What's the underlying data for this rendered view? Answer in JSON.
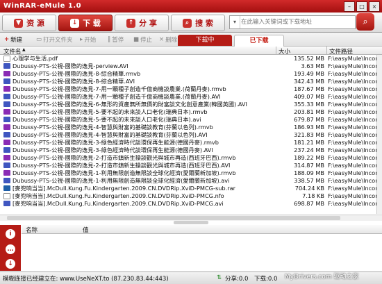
{
  "window": {
    "title": "WinRAR-eMule 1.0"
  },
  "nav": {
    "resources": "资 源",
    "download": "下 载",
    "share": "分 享",
    "search": "搜 索"
  },
  "search": {
    "placeholder": "在此输入关键词或下载地址"
  },
  "toolbar": {
    "new": "新建",
    "open_folder": "打开文件夹",
    "start": "开始",
    "pause": "暂停",
    "stop": "停止",
    "delete": "删除",
    "tab_downloading": "下载中",
    "tab_downloaded": "已下载"
  },
  "columns": {
    "name": "文件名",
    "size": "大小",
    "path": "文件路径"
  },
  "files": [
    {
      "name": "心理学与生活.pdf",
      "size": "135.52 MB",
      "path": "F:\\easyMule\\Incom",
      "type": "pdf"
    },
    {
      "name": "Dubussy-PTS-公視-國際的逸見-perview.AVI",
      "size": "3.63 MB",
      "path": "F:\\easyMule\\Incom",
      "type": "avi"
    },
    {
      "name": "Dubussy-PTS-公視-國際的逸見-8-綜合精華.rmvb",
      "size": "193.49 MB",
      "path": "F:\\easyMule\\Incom",
      "type": "rm"
    },
    {
      "name": "Dubussy-PTS-公視-國際的逸見-8-綜合精華.AVI",
      "size": "342.43 MB",
      "path": "F:\\easyMule\\Incom",
      "type": "avi"
    },
    {
      "name": "Dubussy-PTS-公視-國際的逸見-7-用一顆種子創造千億商機談農業.(荷蘭丹麥).rmvb",
      "size": "187.67 MB",
      "path": "F:\\easyMule\\Incom",
      "type": "rm"
    },
    {
      "name": "Dubussy-PTS-公視-國際的逸見-7-用一顆種子創造千億商機談農業.(荷蘭丹麥).AVI",
      "size": "409.07 MB",
      "path": "F:\\easyMule\\Incom",
      "type": "avi"
    },
    {
      "name": "Dubussy-PTS-公視-國際的逸見-6-無形的資產無所無價的財富談文化創意產業(韓國英國).AVI",
      "size": "355.33 MB",
      "path": "F:\\easyMule\\Incom",
      "type": "avi"
    },
    {
      "name": "Dubussy-PTS-公視-國際的逸見-5-要不起的未來談人口老化(瑞典日本).rmvb",
      "size": "203.81 MB",
      "path": "F:\\easyMule\\Incom",
      "type": "rm"
    },
    {
      "name": "Dubussy-PTS-公視-國際的逸見-5-要不起的未來談人口老化(瑞典日本).avi",
      "size": "679.87 MB",
      "path": "F:\\easyMule\\Incom",
      "type": "avi"
    },
    {
      "name": "Dubussy-PTS-公視-國際的逸見-4-智慧與財富的基礎談教育(芬蘭以色列).rmvb",
      "size": "186.93 MB",
      "path": "F:\\easyMule\\Incom",
      "type": "rm"
    },
    {
      "name": "Dubussy-PTS-公視-國際的逸見-4-智慧與財富的基礎談教育(芬蘭以色列).AVI",
      "size": "321.83 MB",
      "path": "F:\\easyMule\\Incom",
      "type": "avi"
    },
    {
      "name": "Dubussy-PTS-公視-國際的逸見-3-綠色經濟時代談環保再生能源(德國丹麥).rmvb",
      "size": "181.21 MB",
      "path": "F:\\easyMule\\Incom",
      "type": "rm"
    },
    {
      "name": "Dubussy-PTS-公視-國際的逸見-3-綠色經濟時代談環保再生能源(德國丹麥).AVI",
      "size": "237.24 MB",
      "path": "F:\\easyMule\\Incom",
      "type": "avi"
    },
    {
      "name": "Dubussy-PTS-公視-國際的逸見-2-打造市鎮新生操談觀光與城市再造(西班牙巴西).rmvb",
      "size": "189.22 MB",
      "path": "F:\\easyMule\\Incom",
      "type": "rm"
    },
    {
      "name": "Dubussy-PTS-公視-國際的逸見-2-打造市鎮新生操談觀光與城市再造(西班牙巴西).AVI",
      "size": "314.87 MB",
      "path": "F:\\easyMule\\Incom",
      "type": "avi"
    },
    {
      "name": "Dubussy-PTS-公視-國際的逸見-1-利用無限創造無限談全球化經濟(愛爾蘭新加坡).rmvb",
      "size": "188.09 MB",
      "path": "F:\\easyMule\\Incom",
      "type": "rm"
    },
    {
      "name": "Dubussy-PTS-公視-國際的逸見-1-利用無限創造無限談全球化經濟(愛爾蘭新加坡).avi",
      "size": "338.57 MB",
      "path": "F:\\easyMule\\Incom",
      "type": "avi"
    },
    {
      "name": "[麥兜响当当].McDull.Kung.Fu.Kindergarten.2009.CN.DVDRip.XviD-PMCG-sub.rar",
      "size": "704.24 KB",
      "path": "F:\\easyMule\\Incom",
      "type": "bd"
    },
    {
      "name": "[麥兜响当当].McDull.Kung.Fu.Kindergarten.2009.CN.DVDRip.XviD-PMCG.nfo",
      "size": "7.18 KB",
      "path": "F:\\easyMule\\Incom",
      "type": "nfo"
    },
    {
      "name": "[麥兜响当当].McDull.Kung.Fu.Kindergarten.2009.CN.DVDRip.XviD-PMCG.avi",
      "size": "698.87 MB",
      "path": "F:\\easyMule\\Incom",
      "type": "avi"
    }
  ],
  "detail": {
    "col_name": "名称",
    "col_value": "值"
  },
  "status": {
    "server": "模糊连接已经建立在: www.UseNeXT.to (87.230.83.44:443)",
    "share": "分享:0.0",
    "download": "下载:0.0"
  },
  "watermark": "MyDrivers.com 驱动之家"
}
